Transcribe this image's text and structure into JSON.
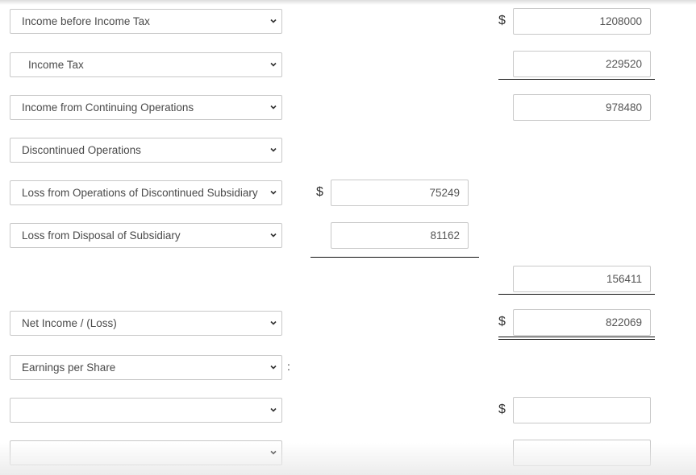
{
  "rows": [
    {
      "label": "Income before Income Tax"
    },
    {
      "label": "Income Tax"
    },
    {
      "label": "Income from Continuing Operations"
    },
    {
      "label": "Discontinued Operations"
    },
    {
      "label": "Loss from Operations of Discontinued Subsidiary"
    },
    {
      "label": "Loss from Disposal of Subsidiary"
    },
    {
      "label": "Net Income / (Loss)"
    },
    {
      "label": "Earnings per Share"
    },
    {
      "label": ""
    },
    {
      "label": ""
    }
  ],
  "values": {
    "income_before_tax": "1208000",
    "income_tax": "229520",
    "income_continuing": "978480",
    "loss_operations_discontinued": "75249",
    "loss_disposal": "81162",
    "total_discontinued": "156411",
    "net_income": "822069",
    "eps_1": "",
    "eps_2": ""
  },
  "symbols": {
    "currency": "$",
    "colon": ":"
  }
}
